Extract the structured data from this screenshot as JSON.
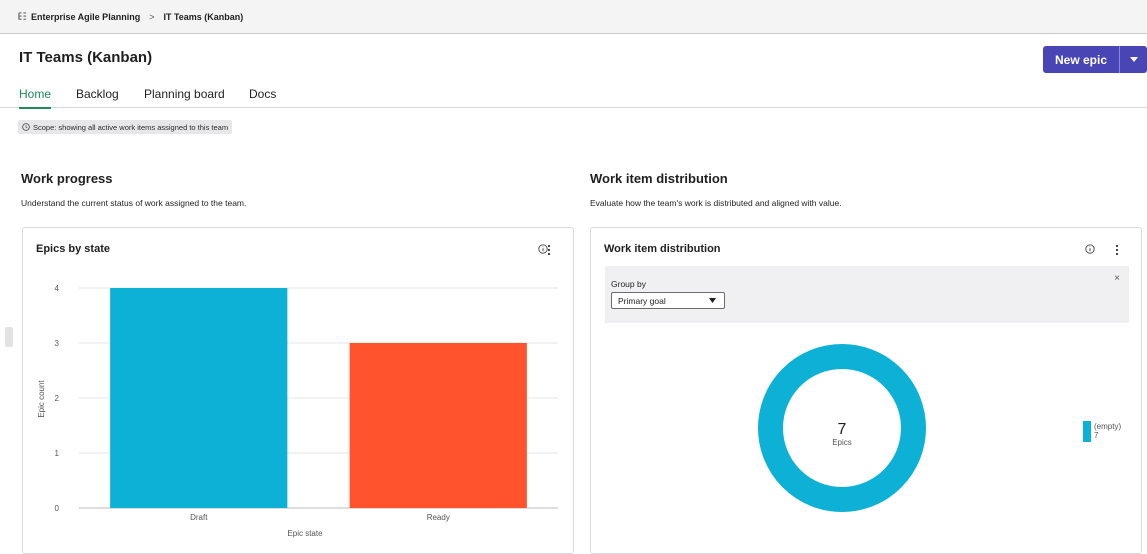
{
  "breadcrumb": {
    "root": "Enterprise Agile Planning",
    "separator": ">",
    "current": "IT Teams (Kanban)"
  },
  "page": {
    "title": "IT Teams (Kanban)",
    "new_epic_label": "New epic"
  },
  "tabs": [
    {
      "label": "Home",
      "active": true
    },
    {
      "label": "Backlog",
      "active": false
    },
    {
      "label": "Planning board",
      "active": false
    },
    {
      "label": "Docs",
      "active": false
    }
  ],
  "scope_text": "Scope: showing all active work items assigned to this team",
  "work_progress": {
    "title": "Work progress",
    "description": "Understand the current status of work assigned to the team.",
    "card_title": "Epics by state"
  },
  "distribution": {
    "title": "Work item distribution",
    "description": "Evaluate how the team's work is distributed and aligned with value.",
    "card_title": "Work item distribution",
    "group_by_label": "Group by",
    "group_by_value": "Primary goal",
    "close_glyph": "×",
    "center_value": "7",
    "center_label": "Epics"
  },
  "colors": {
    "accent": "#4a45b5",
    "tab_active": "#1f8a5a",
    "bar_draft": "#0eb1d6",
    "bar_ready": "#ff532e",
    "donut": "#0eb1d6"
  },
  "chart_data": [
    {
      "type": "bar",
      "title": "Epics by state",
      "categories": [
        "Draft",
        "Ready"
      ],
      "values": [
        4,
        3
      ],
      "xlabel": "Epic state",
      "ylabel": "Epic count",
      "ylim": [
        0,
        4
      ],
      "yticks": [
        "0",
        "1",
        "2",
        "3",
        "4"
      ],
      "grid": true
    },
    {
      "type": "pie",
      "title": "Work item distribution",
      "donut": true,
      "categories": [
        "(empty)"
      ],
      "values": [
        7
      ],
      "legend_placement": "right"
    }
  ]
}
